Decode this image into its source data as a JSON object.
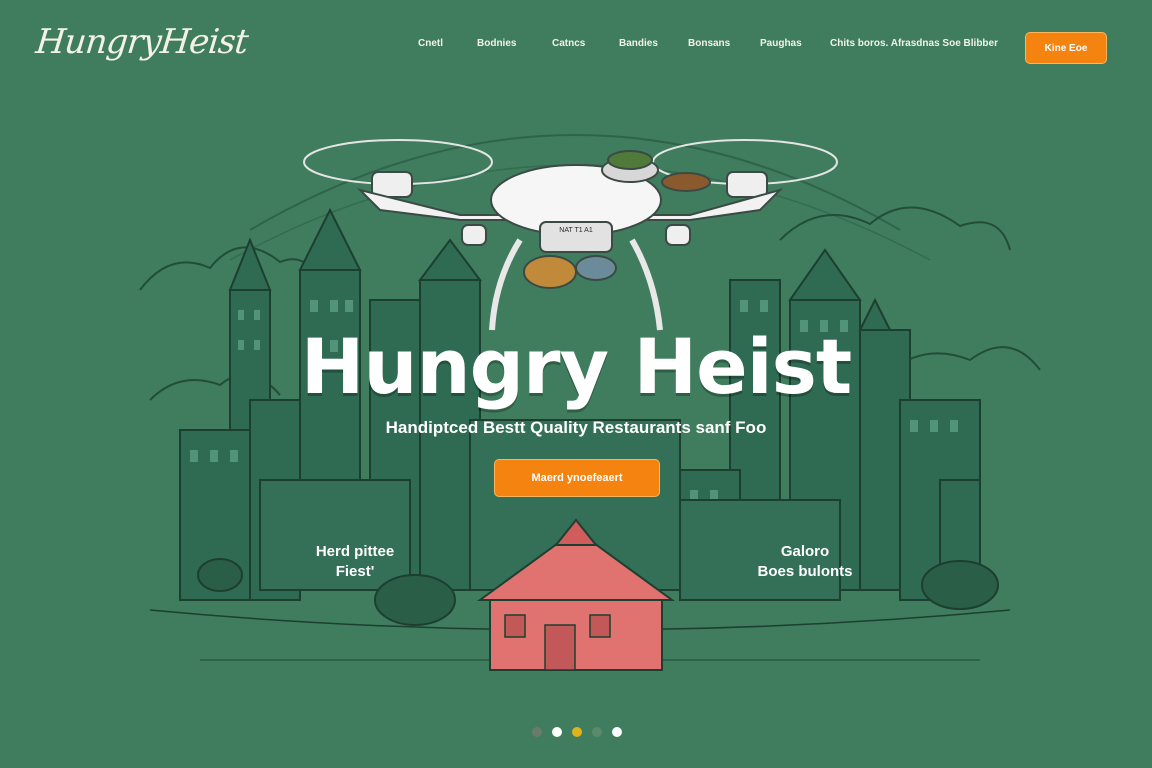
{
  "brand": {
    "logo_text": "HungryHeist"
  },
  "nav": {
    "items": [
      "Cnetl",
      "Bodnies",
      "Catncs",
      "Bandies",
      "Bonsans",
      "Paughas",
      "Chits boros. Afrasdnas Soe Blibber"
    ],
    "cta_label": "Kine Eoe"
  },
  "hero": {
    "title": "Hungry Heist",
    "subtitle": "Handiptced Bestt Quality Restaurants sanf Foo",
    "cta_label": "Maerd ynoefeaert",
    "drone_label": "NAT T1 A1",
    "left_label_line1": "Herd pittee",
    "left_label_line2": "Fiest'",
    "right_label_line1": "Galoro",
    "right_label_line2": "Boes bulonts"
  },
  "carousel": {
    "dot_count": 5,
    "active_index": 2,
    "dot_colors": [
      "#6b7b6a",
      "#ffffff",
      "#e2b21a",
      "#5a8a6b",
      "#ffffff"
    ]
  },
  "colors": {
    "background": "#3f7d5e",
    "accent": "#f4830f",
    "pavilion": "#e07270"
  }
}
